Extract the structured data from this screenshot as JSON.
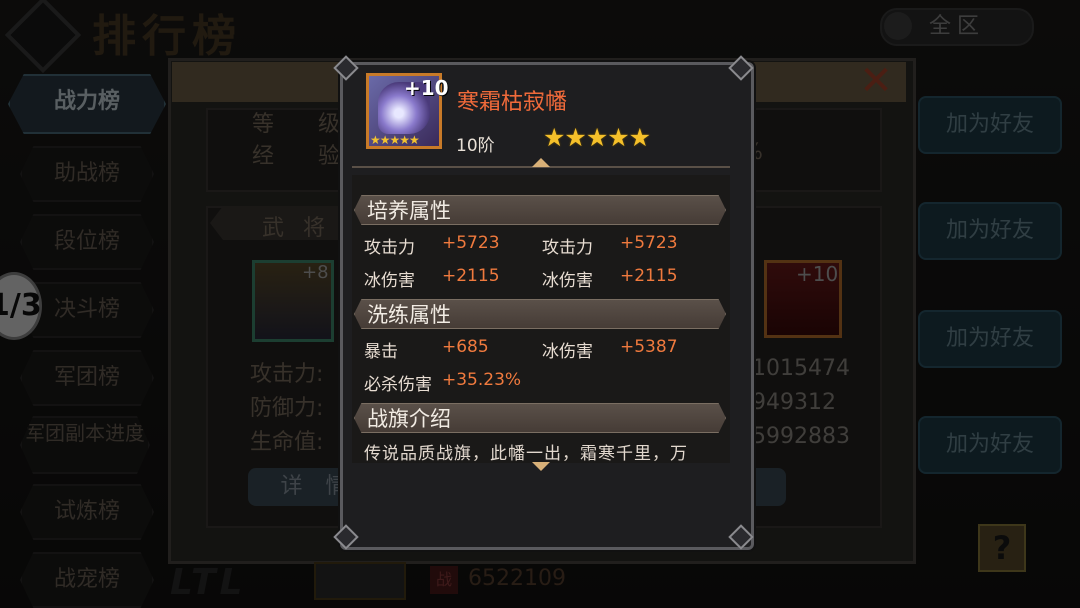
{
  "header": {
    "title": "排行榜",
    "zone_label": "全区"
  },
  "sidebar": {
    "items": [
      {
        "label": "战力榜"
      },
      {
        "label": "助战榜"
      },
      {
        "label": "段位榜"
      },
      {
        "label": "决斗榜"
      },
      {
        "label": "军团榜"
      },
      {
        "label": "军团副本进度"
      },
      {
        "label": "试炼榜"
      },
      {
        "label": "战宠榜"
      }
    ],
    "circle_badge": "1/3"
  },
  "panel": {
    "row_top": {
      "label1": "等　　级",
      "label2": "经　　验",
      "suffix": "%"
    },
    "generals_label": "武 将",
    "left_avatar_plus": "+8",
    "right_avatar_plus": "+10",
    "stats_labels": [
      "攻击力:",
      "防御力:",
      "生命值:"
    ],
    "right_values": [
      "1015474",
      "949312",
      "5992883"
    ],
    "detail_label": "详 情",
    "add_friend_label": "加为好友"
  },
  "bottom": {
    "rank_text": "LTL",
    "power_icon": "战",
    "power_value": "6522109"
  },
  "popup": {
    "item_plus": "+10",
    "item_name": "寒霜枯寂幡",
    "tier": "10阶",
    "stars": "★★★★★",
    "mini_stars": "★★★★★",
    "section1": {
      "title": "培养属性",
      "rows": [
        {
          "l1": "攻击力",
          "v1": "+5723",
          "l2": "攻击力",
          "v2": "+5723"
        },
        {
          "l1": "冰伤害",
          "v1": "+2115",
          "l2": "冰伤害",
          "v2": "+2115"
        }
      ]
    },
    "section2": {
      "title": "洗练属性",
      "rows": [
        {
          "l1": "暴击",
          "v1": "+685",
          "l2": "冰伤害",
          "v2": "+5387"
        },
        {
          "l1": "必杀伤害",
          "v1": "+35.23%"
        }
      ]
    },
    "section3": {
      "title": "战旗介绍",
      "desc": "传说品质战旗，此幡一出，霜寒千里，万"
    }
  },
  "colors": {
    "item_name": "#f06a3a",
    "value": "#f07a3e",
    "star": "#f5c02a"
  }
}
